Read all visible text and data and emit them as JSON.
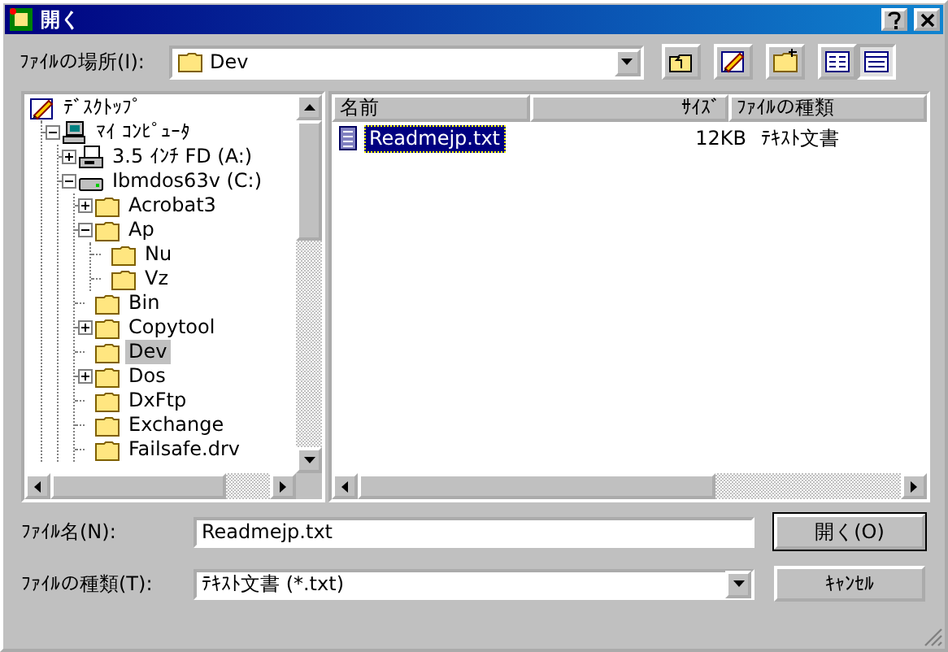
{
  "window": {
    "title": "開く"
  },
  "look_in": {
    "label": "ﾌｧｲﾙの場所(I):",
    "value": "Dev"
  },
  "toolbar": {
    "view_buttons": [
      {
        "selected": false
      },
      {
        "selected": true
      }
    ]
  },
  "tree": [
    {
      "label": "ﾃﾞｽｸﾄｯﾌﾟ",
      "kind": "desktop",
      "selected": false,
      "children": [
        {
          "label": "ﾏｲ ｺﾝﾋﾟｭｰﾀ",
          "kind": "computer",
          "expanded": true,
          "selected": false,
          "children": [
            {
              "label": "3.5 ｲﾝﾁ FD (A:)",
              "kind": "floppy",
              "expanded": false,
              "selected": false
            },
            {
              "label": "Ibmdos63v (C:)",
              "kind": "drive",
              "expanded": true,
              "selected": false,
              "children": [
                {
                  "label": "Acrobat3",
                  "kind": "folder",
                  "expanded": false,
                  "selected": false
                },
                {
                  "label": "Ap",
                  "kind": "folder",
                  "expanded": true,
                  "selected": false,
                  "children": [
                    {
                      "label": "Nu",
                      "kind": "folder",
                      "selected": false
                    },
                    {
                      "label": "Vz",
                      "kind": "folder",
                      "selected": false
                    }
                  ]
                },
                {
                  "label": "Bin",
                  "kind": "folder",
                  "selected": false
                },
                {
                  "label": "Copytool",
                  "kind": "folder",
                  "expanded": false,
                  "selected": false
                },
                {
                  "label": "Dev",
                  "kind": "folder",
                  "selected": true
                },
                {
                  "label": "Dos",
                  "kind": "folder",
                  "expanded": false,
                  "selected": false
                },
                {
                  "label": "DxFtp",
                  "kind": "folder",
                  "selected": false
                },
                {
                  "label": "Exchange",
                  "kind": "folder",
                  "selected": false
                },
                {
                  "label": "Failsafe.drv",
                  "kind": "folder",
                  "selected": false
                }
              ]
            }
          ]
        }
      ]
    }
  ],
  "file_list": {
    "columns": [
      "名前",
      "ｻｲｽﾞ",
      "ﾌｧｲﾙの種類"
    ],
    "rows": [
      {
        "name": "Readmejp.txt",
        "size": "12KB",
        "type": "ﾃｷｽﾄ文書",
        "selected": true
      }
    ]
  },
  "file_name": {
    "label": "ﾌｧｲﾙ名(N):",
    "value": "Readmejp.txt"
  },
  "file_type": {
    "label": "ﾌｧｲﾙの種類(T):",
    "value": "ﾃｷｽﾄ文書 (*.txt)"
  },
  "buttons": [
    "開く(O)",
    "ｷｬﾝｾﾙ"
  ]
}
